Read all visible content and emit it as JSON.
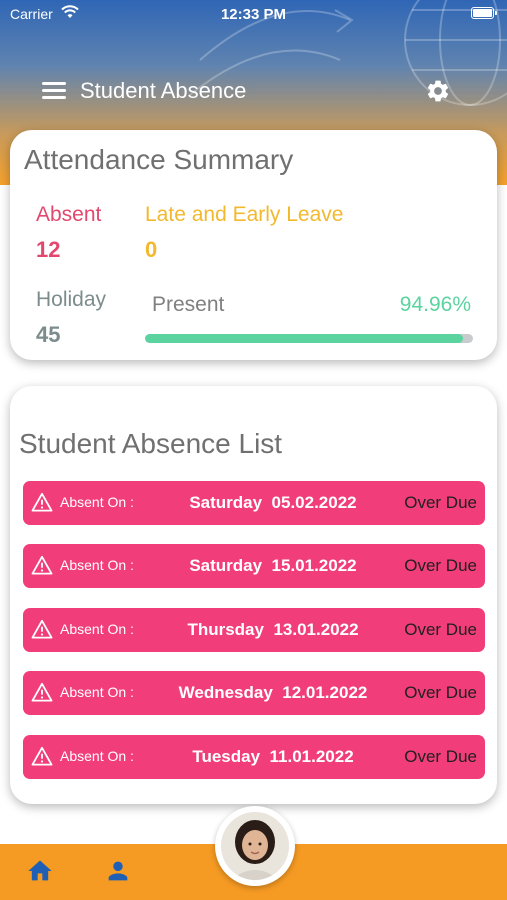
{
  "status_bar": {
    "carrier": "Carrier",
    "time": "12:33 PM"
  },
  "header": {
    "title": "Student Absence",
    "menu_icon": "hamburger-menu-icon",
    "settings_icon": "gear-icon"
  },
  "summary": {
    "title": "Attendance Summary",
    "absent": {
      "label": "Absent",
      "value": "12",
      "color": "#e2486e"
    },
    "late_early": {
      "label": "Late and Early Leave",
      "value": "0",
      "color": "#f2b92e"
    },
    "holiday": {
      "label": "Holiday",
      "value": "45",
      "color": "#7c8c8c"
    },
    "present": {
      "label": "Present",
      "percent_text": "94.96%",
      "percent": 96.96,
      "color": "#5bd39f"
    }
  },
  "absence_list": {
    "title": "Student Absence List",
    "items": [
      {
        "label": "Absent On :",
        "day": "Saturday",
        "date": "05.02.2022",
        "status": "Over Due"
      },
      {
        "label": "Absent On :",
        "day": "Saturday",
        "date": "15.01.2022",
        "status": "Over Due"
      },
      {
        "label": "Absent On :",
        "day": "Thursday",
        "date": "13.01.2022",
        "status": "Over Due"
      },
      {
        "label": "Absent On :",
        "day": "Wednesday",
        "date": "12.01.2022",
        "status": "Over Due"
      },
      {
        "label": "Absent On :",
        "day": "Tuesday",
        "date": "11.01.2022",
        "status": "Over Due"
      }
    ]
  },
  "bottom_nav": {
    "home_icon": "home-icon",
    "profile_icon": "person-icon",
    "avatar": "student-avatar"
  },
  "colors": {
    "accent_pink": "#f13e7a",
    "bottom_bar": "#f59a23",
    "header_top": "#2f66b5"
  }
}
